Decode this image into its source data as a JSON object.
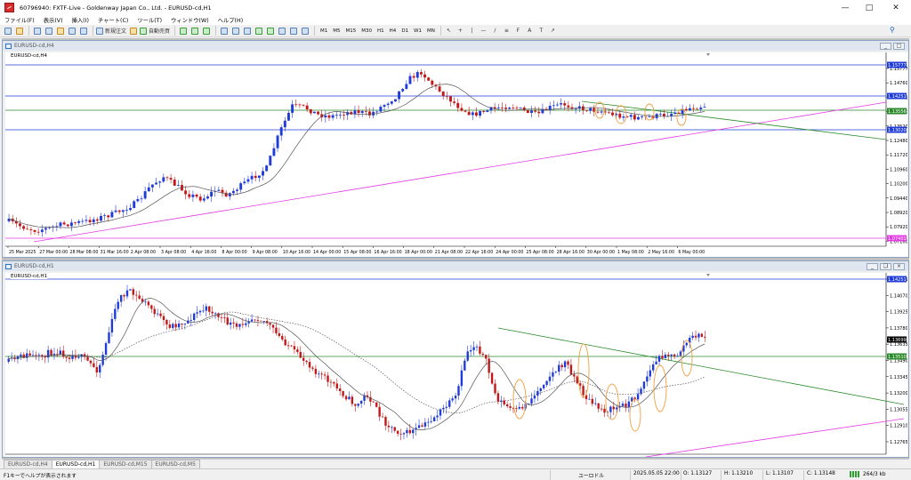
{
  "window": {
    "title": "60796940: FXTF-Live - Goldenway Japan Co., Ltd. - EURUSD-cd,H1"
  },
  "menu": [
    "ファイル(F)",
    "表示(V)",
    "挿入(I)",
    "チャート(C)",
    "ツール(T)",
    "ウィンドウ(W)",
    "ヘルプ(H)"
  ],
  "toolbar": {
    "new_order_label": "新規注文",
    "auto_trade_label": "自動売買",
    "timeframes": [
      "M1",
      "M5",
      "M15",
      "M30",
      "H1",
      "H4",
      "D1",
      "W1",
      "MN"
    ],
    "icons": [
      "new-chart-icon",
      "profiles-icon",
      "market-watch-icon",
      "data-window-icon",
      "navigator-icon",
      "terminal-icon",
      "tester-icon",
      "new-order-icon",
      "metaeditor-icon",
      "auto-trading-icon",
      "bar-chart-icon",
      "candle-chart-icon",
      "line-chart-icon",
      "zoom-in-icon",
      "zoom-out-icon",
      "tile-icon",
      "scroll-icon",
      "shift-icon",
      "indicators-icon",
      "periods-icon",
      "templates-icon",
      "cursor-icon",
      "crosshair-icon",
      "vertical-line-icon",
      "horizontal-line-icon",
      "trendline-icon",
      "channel-icon",
      "fibonacci-icon",
      "text-icon",
      "label-icon",
      "arrows-icon"
    ]
  },
  "charts": [
    {
      "window_title": "EURUSD-cd,H4",
      "symbol_label": "EURUSD-cd,H4",
      "price_labels": [
        "1.15777",
        "1.14760",
        "1.14251",
        "1.14000",
        "1.13520",
        "1.12480",
        "1.11720",
        "1.10960",
        "1.10200",
        "1.09440",
        "1.08920",
        "1.07920",
        "1.07160"
      ],
      "highlight_labels": [
        {
          "text": "1.15777",
          "color": "#1f3bd9"
        },
        {
          "text": "1.14251",
          "color": "#1f3bd9"
        },
        {
          "text": "1.13556",
          "color": "#2a8a2a"
        },
        {
          "text": "1.13020",
          "color": "#1f3bd9"
        },
        {
          "text": "1.07401",
          "color": "#e33be3"
        }
      ],
      "time_labels": [
        "25 Mar 2025",
        "27 Mar 00:00",
        "28 Mar 08:00",
        "31 Mar 16:00",
        "2 Apr 08:00",
        "3 Apr 08:00",
        "4 Apr 16:00",
        "8 Apr 00:00",
        "9 Apr 08:00",
        "10 Apr 16:00",
        "14 Apr 00:00",
        "15 Apr 08:00",
        "16 Apr 16:00",
        "18 Apr 00:00",
        "21 Apr 08:00",
        "22 Apr 16:00",
        "24 Apr 00:00",
        "25 Apr 08:00",
        "28 Apr 16:00",
        "30 Apr 00:00",
        "1 May 08:00",
        "2 May 16:00",
        "6 May 00:00"
      ]
    },
    {
      "window_title": "EURUSD-cd,H1",
      "symbol_label": "EURUSD-cd,H1",
      "price_labels": [
        "1.14251",
        "1.14070",
        "1.13925",
        "1.13780",
        "1.13635",
        "1.13490",
        "1.13345",
        "1.13200",
        "1.13055",
        "1.12910",
        "1.12765"
      ],
      "highlight_labels": [
        {
          "text": "1.14251",
          "color": "#1f3bd9"
        },
        {
          "text": "1.13699",
          "color": "#000000"
        },
        {
          "text": "1.13510",
          "color": "#2a8a2a"
        }
      ],
      "time_labels": []
    }
  ],
  "tabs": [
    "EURUSD-cd,H4",
    "EURUSD-cd,H1",
    "EURUSD-cd,M15",
    "EURUSD-cd,M5"
  ],
  "active_tab": 1,
  "status": {
    "help": "F1キーでヘルプが表示されます",
    "profile": "ユーロドル",
    "datetime": "2025.05.05 22:00",
    "open": "O: 1.13127",
    "high": "H: 1.13210",
    "low": "L: 1.13107",
    "close": "C: 1.13148",
    "volume": "V: 1818",
    "connection": "264/3 kb"
  },
  "colors": {
    "bull": "#1f3bd9",
    "bear": "#c21818",
    "resistance": "#1f3bd9",
    "support": "#2a8a2a",
    "trendline": "#e33be3",
    "ma": "#555555",
    "highlight": "#f0a040"
  }
}
